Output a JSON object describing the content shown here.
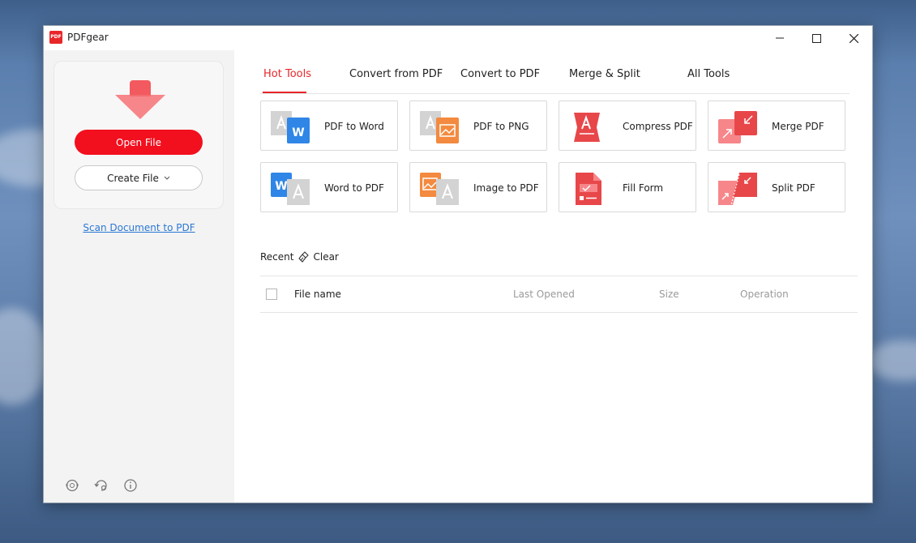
{
  "window": {
    "title": "PDFgear",
    "logo_text": "PDF"
  },
  "sidebar": {
    "open_file_label": "Open File",
    "create_file_label": "Create File",
    "scan_link": "Scan Document to PDF",
    "bottom_icons": [
      "support-icon",
      "history-icon",
      "info-icon"
    ]
  },
  "tabs": [
    {
      "label": "Hot Tools",
      "active": true
    },
    {
      "label": "Convert from PDF"
    },
    {
      "label": "Convert to PDF"
    },
    {
      "label": "Merge & Split"
    },
    {
      "label": "All Tools"
    }
  ],
  "tools": [
    {
      "label": "PDF to Word",
      "icon": "pdf-to-word-icon"
    },
    {
      "label": "PDF to PNG",
      "icon": "pdf-to-png-icon"
    },
    {
      "label": "Compress PDF",
      "icon": "compress-pdf-icon"
    },
    {
      "label": "Merge PDF",
      "icon": "merge-pdf-icon"
    },
    {
      "label": "Word to PDF",
      "icon": "word-to-pdf-icon"
    },
    {
      "label": "Image to PDF",
      "icon": "image-to-pdf-icon"
    },
    {
      "label": "Fill Form",
      "icon": "fill-form-icon"
    },
    {
      "label": "Split PDF",
      "icon": "split-pdf-icon"
    }
  ],
  "recent": {
    "label": "Recent",
    "clear_label": "Clear",
    "columns": [
      "File name",
      "Last Opened",
      "Size",
      "Operation"
    ]
  },
  "colors": {
    "accent": "#f20f1e",
    "tab_active": "#e8262a",
    "link": "#2a77d4",
    "word_blue": "#2f86e6",
    "image_orange": "#f38a3f",
    "pdf_red": "#e8474a"
  }
}
